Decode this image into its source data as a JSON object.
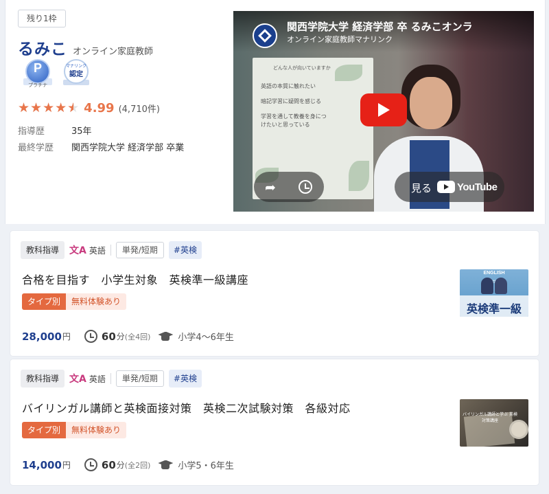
{
  "profile": {
    "slot_badge": "残り1枠",
    "name": "るみこ",
    "subtitle": "オンライン家庭教師",
    "badges": {
      "platinum_letter": "P",
      "platinum_label": "プラチナ",
      "certified_small": "マナリンク",
      "certified_big": "認定"
    },
    "rating": {
      "value": "4.99",
      "count": "(4,710件)",
      "stars_fraction": 0.9
    },
    "experience": {
      "label": "指導歴",
      "value": "35年"
    },
    "education": {
      "label": "最終学歴",
      "value": "関西学院大学 経済学部 卒業"
    }
  },
  "video": {
    "title": "関西学院大学 経済学部 卒 るみこオンラ",
    "channel": "オンライン家庭教師マナリンク",
    "board_title": "どんな人が向いていますか",
    "board_lines": [
      "英語の本質に触れたい",
      "暗記学習に疑問を感じる",
      "学習を通して教養を身につ",
      "けたいと思っている"
    ],
    "watch_label": "見る",
    "youtube_word": "YouTube"
  },
  "courses": [
    {
      "category": "教科指導",
      "language_glyph": "文A",
      "language": "英語",
      "term": "単発/短期",
      "hashtag": "#英検",
      "title": "合格を目指す　小学生対象　英検準一級講座",
      "type_tag": "タイプ別",
      "trial_tag": "無料体験あり",
      "price": "28,000",
      "currency": "円",
      "minutes": "60",
      "minute_unit": "分",
      "lessons": "(全4回)",
      "grade": "小学4〜6年生",
      "thumb": {
        "en": "ENGLISH",
        "slogan": "目指せ合格",
        "big": "英検準一級"
      }
    },
    {
      "category": "教科指導",
      "language_glyph": "文A",
      "language": "英語",
      "term": "単発/短期",
      "hashtag": "#英検",
      "title": "バイリンガル講師と英検面接対策　英検二次試験対策　各級対応",
      "type_tag": "タイプ別",
      "trial_tag": "無料体験あり",
      "price": "14,000",
      "currency": "円",
      "minutes": "60",
      "minute_unit": "分",
      "lessons": "(全2回)",
      "grade": "小学5・6年生",
      "thumb": {
        "caption": "バイリンガル講師と学ぶ 英検対策講座"
      }
    }
  ]
}
